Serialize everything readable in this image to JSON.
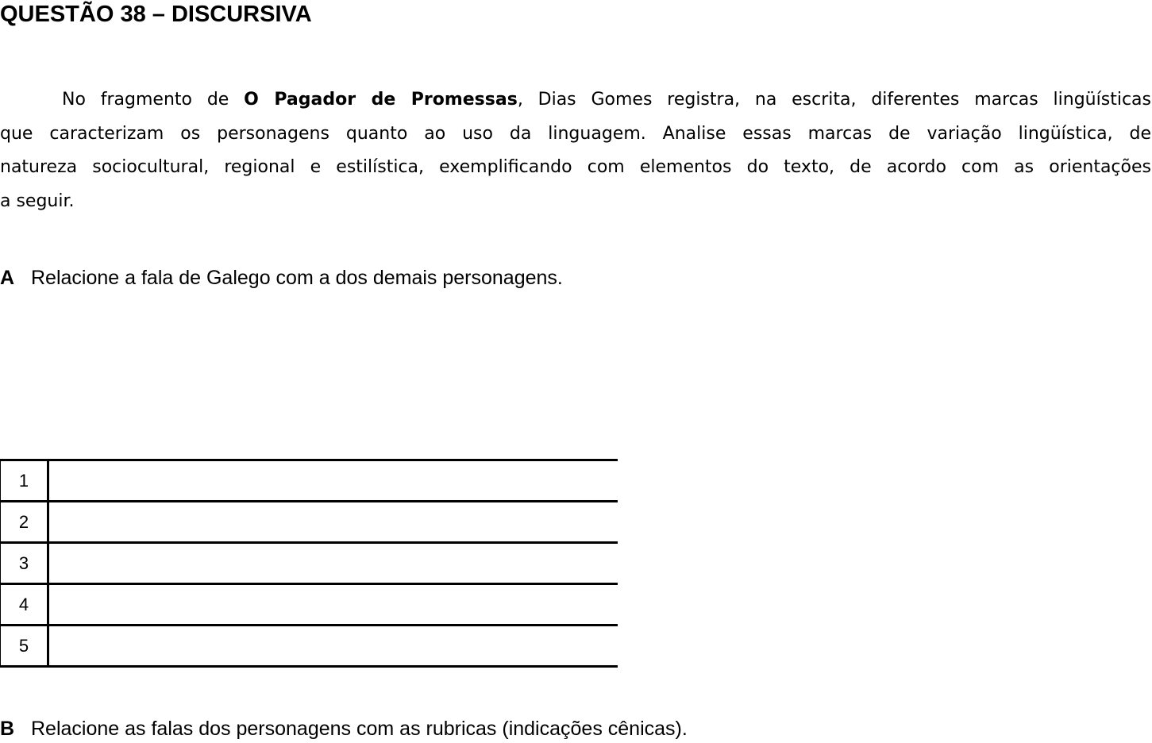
{
  "title": "QUESTÃO 38 – DISCURSIVA",
  "paragraph": {
    "line1_pre": "No fragmento de ",
    "line1_bold": "O Pagador de Promessas",
    "line1_post": ", Dias Gomes registra, na escrita, diferentes marcas lingüísticas",
    "line2": "que caracterizam os personagens quanto ao uso da linguagem. Analise essas marcas de variação lingüística, de",
    "line3": "natureza sociocultural, regional e estilística, exemplificando com elementos do texto, de acordo com as orientações",
    "line4": "a seguir."
  },
  "items": [
    {
      "letter": "A",
      "text": "Relacione a fala de Galego com a dos demais personagens."
    },
    {
      "letter": "B",
      "text": "Relacione as falas dos personagens com as rubricas (indicações cênicas)."
    }
  ],
  "answer_lines": [
    "1",
    "2",
    "3",
    "4",
    "5"
  ]
}
